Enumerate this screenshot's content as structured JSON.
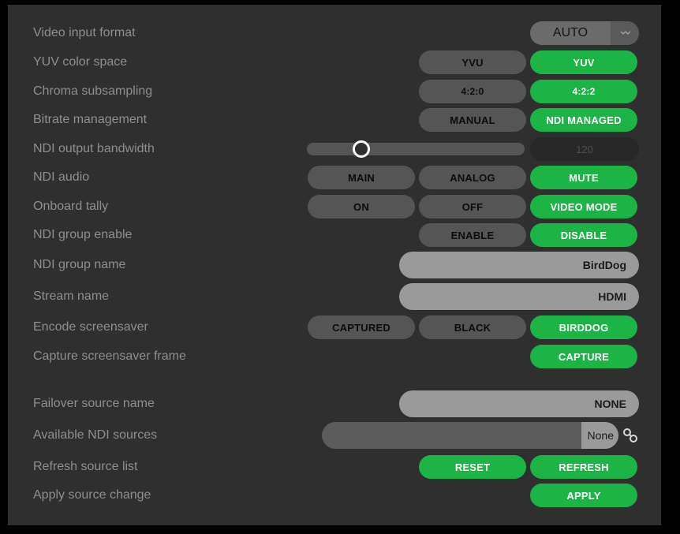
{
  "settings": {
    "video_input_format": {
      "label": "Video input format",
      "value": "AUTO",
      "arrow": "▾"
    },
    "yuv_color_space": {
      "label": "YUV color space",
      "options": [
        "YVU",
        "YUV"
      ],
      "selected": "YUV"
    },
    "chroma_subsampling": {
      "label": "Chroma subsampling",
      "options": [
        "4:2:0",
        "4:2:2"
      ],
      "selected": "4:2:2"
    },
    "bitrate_management": {
      "label": "Bitrate management",
      "options": [
        "MANUAL",
        "NDI MANAGED"
      ],
      "selected": "NDI MANAGED"
    },
    "ndi_output_bandwidth": {
      "label": "NDI output bandwidth",
      "value": "120",
      "slider_fraction": 0.25
    },
    "ndi_audio": {
      "label": "NDI audio",
      "options": [
        "MAIN",
        "ANALOG",
        "MUTE"
      ],
      "selected": "MUTE"
    },
    "onboard_tally": {
      "label": "Onboard tally",
      "options": [
        "ON",
        "OFF",
        "VIDEO MODE"
      ],
      "selected": "VIDEO MODE"
    },
    "ndi_group_enable": {
      "label": "NDI group enable",
      "options": [
        "ENABLE",
        "DISABLE"
      ],
      "selected": "DISABLE"
    },
    "ndi_group_name": {
      "label": "NDI group name",
      "value": "BirdDog"
    },
    "stream_name": {
      "label": "Stream name",
      "value": "HDMI"
    },
    "encode_screensaver": {
      "label": "Encode screensaver",
      "options": [
        "CAPTURED",
        "BLACK",
        "BIRDDOG"
      ],
      "selected": "BIRDDOG"
    },
    "capture_screensaver_frame": {
      "label": "Capture screensaver frame",
      "button": "CAPTURE"
    },
    "failover_source_name": {
      "label": "Failover source name",
      "value": "NONE"
    },
    "available_ndi_sources": {
      "label": "Available NDI sources",
      "value": "None"
    },
    "refresh_source_list": {
      "label": "Refresh source list",
      "buttons": [
        "RESET",
        "REFRESH"
      ]
    },
    "apply_source_change": {
      "label": "Apply source change",
      "button": "APPLY"
    }
  },
  "colors": {
    "panel_bg": "#2f2f2f",
    "active_green": "#1db446",
    "inactive_button": "#555555",
    "label_gray": "#8e8e8e",
    "input_bg": "#9a9a9a"
  },
  "icons": {
    "dropdown_arrow": "chevron-down-icon",
    "link": "link-icon"
  }
}
